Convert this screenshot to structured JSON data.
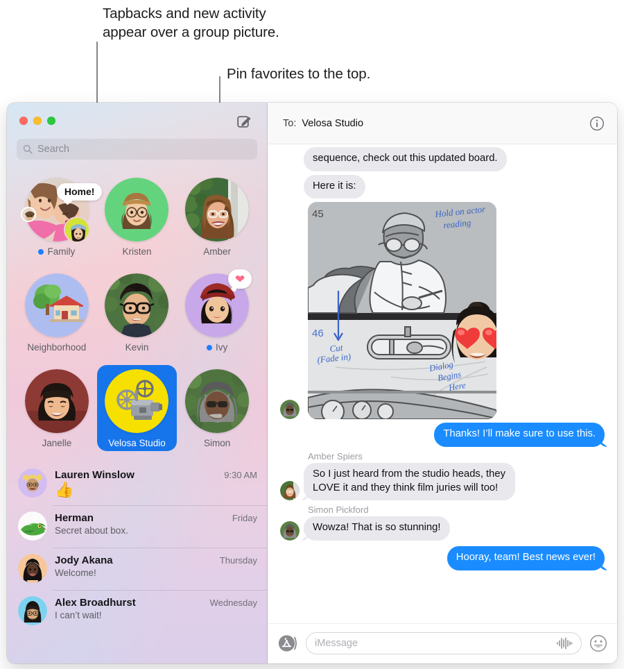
{
  "annotations": [
    {
      "id": "tapbacks",
      "text": "Tapbacks and new activity\nappear over a group picture."
    },
    {
      "id": "pin",
      "text": "Pin favorites to the top."
    }
  ],
  "colors": {
    "accent_blue": "#1a8cff",
    "selected_pin_blue": "#1775ec",
    "unread_dot": "#1d7efd",
    "tapback_heart": "#ff6b8a",
    "incoming_bubble": "#e8e8ed",
    "traffic_close": "#fb6b5f",
    "traffic_min": "#fcbc2e",
    "traffic_max": "#2bc93e",
    "sidebar_gradient_start": "#f7d9da",
    "sidebar_gradient_end": "#dbcfea"
  },
  "window": {
    "compose_icon": "compose-pencil-icon",
    "traffic_lights": [
      "close",
      "minimize",
      "maximize"
    ]
  },
  "search": {
    "icon": "search-icon",
    "placeholder": "Search",
    "value": ""
  },
  "pinned": [
    {
      "label": "Family",
      "unread": true,
      "selected": false,
      "kind": "group-photo",
      "tapback_text": "Home!",
      "tapback_heart": false
    },
    {
      "label": "Kristen",
      "unread": false,
      "selected": false,
      "kind": "memoji-green",
      "tapback_text": null,
      "tapback_heart": false
    },
    {
      "label": "Amber",
      "unread": false,
      "selected": false,
      "kind": "photo-amber",
      "tapback_text": null,
      "tapback_heart": false
    },
    {
      "label": "Neighborhood",
      "unread": false,
      "selected": false,
      "kind": "house-emoji",
      "tapback_text": null,
      "tapback_heart": false
    },
    {
      "label": "Kevin",
      "unread": false,
      "selected": false,
      "kind": "photo-kevin",
      "tapback_text": null,
      "tapback_heart": false
    },
    {
      "label": "Ivy",
      "unread": true,
      "selected": false,
      "kind": "memoji-purple",
      "tapback_text": null,
      "tapback_heart": true
    },
    {
      "label": "Janelle",
      "unread": false,
      "selected": false,
      "kind": "photo-janelle",
      "tapback_text": null,
      "tapback_heart": false
    },
    {
      "label": "Velosa Studio",
      "unread": false,
      "selected": true,
      "kind": "projector-emoji",
      "tapback_text": null,
      "tapback_heart": false
    },
    {
      "label": "Simon",
      "unread": false,
      "selected": false,
      "kind": "photo-simon",
      "tapback_text": null,
      "tapback_heart": false
    }
  ],
  "conversations": [
    {
      "name": "Lauren Winslow",
      "time": "9:30 AM",
      "preview": "👍",
      "preview_is_emoji": true,
      "avatar": "memoji-lauren"
    },
    {
      "name": "Herman",
      "time": "Friday",
      "preview": "Secret about box.",
      "preview_is_emoji": false,
      "avatar": "iguana-photo"
    },
    {
      "name": "Jody Akana",
      "time": "Thursday",
      "preview": "Welcome!",
      "preview_is_emoji": false,
      "avatar": "memoji-jody"
    },
    {
      "name": "Alex Broadhurst",
      "time": "Wednesday",
      "preview": "I can’t wait!",
      "preview_is_emoji": false,
      "avatar": "memoji-alex"
    }
  ],
  "chat": {
    "to_label": "To:",
    "recipient": "Velosa Studio",
    "info_icon": "info-circle-icon",
    "messages": [
      {
        "type": "text",
        "direction": "in",
        "sender": null,
        "text": "sequence, check out this updated board.",
        "show_avatar": false,
        "tail": false
      },
      {
        "type": "text",
        "direction": "in",
        "sender": null,
        "text": "Here it is:",
        "show_avatar": false,
        "tail": false
      },
      {
        "type": "attachment",
        "direction": "in",
        "sender": null,
        "attachment": "storyboard-sketch",
        "show_avatar": true,
        "attachment_annotations": [
          "45",
          "Hold on actor reading",
          "46",
          "Cut (Fade in)",
          "Dialog Begins Here"
        ],
        "reaction": "heart-eyes-memoji"
      },
      {
        "type": "text",
        "direction": "out",
        "sender": null,
        "text": "Thanks! I’ll make sure to use this.",
        "show_avatar": false,
        "tail": true
      },
      {
        "type": "text",
        "direction": "in",
        "sender": "Amber Spiers",
        "text": "So I just heard from the studio heads, they LOVE it and they think film juries will too!",
        "show_avatar": true,
        "tail": true
      },
      {
        "type": "text",
        "direction": "in",
        "sender": "Simon Pickford",
        "text": "Wowza! That is so stunning!",
        "show_avatar": true,
        "tail": true
      },
      {
        "type": "text",
        "direction": "out",
        "sender": null,
        "text": "Hooray, team! Best news ever!",
        "show_avatar": false,
        "tail": true
      }
    ]
  },
  "input_bar": {
    "apps_icon": "app-store-icon",
    "placeholder": "iMessage",
    "value": "",
    "audio_icon": "audio-waveform-icon",
    "emoji_icon": "smiley-face-icon"
  }
}
